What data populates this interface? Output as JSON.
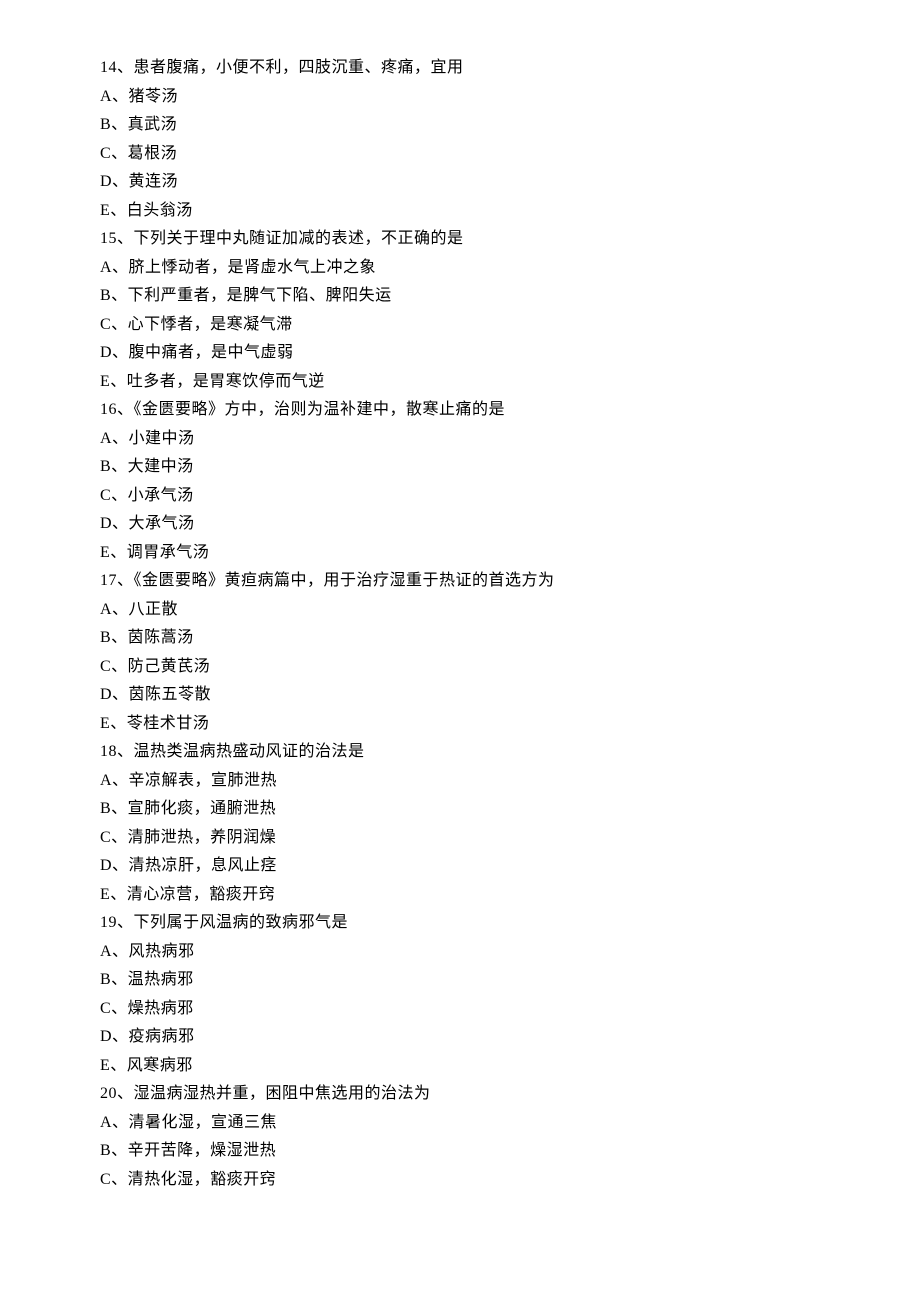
{
  "questions": [
    {
      "number": "14",
      "text": "患者腹痛，小便不利，四肢沉重、疼痛，宜用",
      "options": [
        {
          "letter": "A",
          "text": "猪苓汤"
        },
        {
          "letter": "B",
          "text": "真武汤"
        },
        {
          "letter": "C",
          "text": "葛根汤"
        },
        {
          "letter": "D",
          "text": "黄连汤"
        },
        {
          "letter": "E",
          "text": "白头翁汤"
        }
      ]
    },
    {
      "number": "15",
      "text": "下列关于理中丸随证加减的表述，不正确的是",
      "options": [
        {
          "letter": "A",
          "text": "脐上悸动者，是肾虚水气上冲之象"
        },
        {
          "letter": "B",
          "text": "下利严重者，是脾气下陷、脾阳失运"
        },
        {
          "letter": "C",
          "text": "心下悸者，是寒凝气滞"
        },
        {
          "letter": "D",
          "text": "腹中痛者，是中气虚弱"
        },
        {
          "letter": "E",
          "text": "吐多者，是胃寒饮停而气逆"
        }
      ]
    },
    {
      "number": "16",
      "text": "《金匮要略》方中，治则为温补建中，散寒止痛的是",
      "options": [
        {
          "letter": "A",
          "text": "小建中汤"
        },
        {
          "letter": "B",
          "text": "大建中汤"
        },
        {
          "letter": "C",
          "text": "小承气汤"
        },
        {
          "letter": "D",
          "text": "大承气汤"
        },
        {
          "letter": "E",
          "text": "调胃承气汤"
        }
      ]
    },
    {
      "number": "17",
      "text": "《金匮要略》黄疸病篇中，用于治疗湿重于热证的首选方为",
      "options": [
        {
          "letter": "A",
          "text": "八正散"
        },
        {
          "letter": "B",
          "text": "茵陈蒿汤"
        },
        {
          "letter": "C",
          "text": "防己黄芪汤"
        },
        {
          "letter": "D",
          "text": "茵陈五苓散"
        },
        {
          "letter": "E",
          "text": "苓桂术甘汤"
        }
      ]
    },
    {
      "number": "18",
      "text": "温热类温病热盛动风证的治法是",
      "options": [
        {
          "letter": "A",
          "text": "辛凉解表，宣肺泄热"
        },
        {
          "letter": "B",
          "text": "宣肺化痰，通腑泄热"
        },
        {
          "letter": "C",
          "text": "清肺泄热，养阴润燥"
        },
        {
          "letter": "D",
          "text": "清热凉肝，息风止痉"
        },
        {
          "letter": "E",
          "text": "清心凉营，豁痰开窍"
        }
      ]
    },
    {
      "number": "19",
      "text": "下列属于风温病的致病邪气是",
      "options": [
        {
          "letter": "A",
          "text": "风热病邪"
        },
        {
          "letter": "B",
          "text": "温热病邪"
        },
        {
          "letter": "C",
          "text": "燥热病邪"
        },
        {
          "letter": "D",
          "text": "疫病病邪"
        },
        {
          "letter": "E",
          "text": "风寒病邪"
        }
      ]
    },
    {
      "number": "20",
      "text": "湿温病湿热并重，困阻中焦选用的治法为",
      "options": [
        {
          "letter": "A",
          "text": "清暑化湿，宣通三焦"
        },
        {
          "letter": "B",
          "text": "辛开苦降，燥湿泄热"
        },
        {
          "letter": "C",
          "text": "清热化湿，豁痰开窍"
        }
      ]
    }
  ]
}
